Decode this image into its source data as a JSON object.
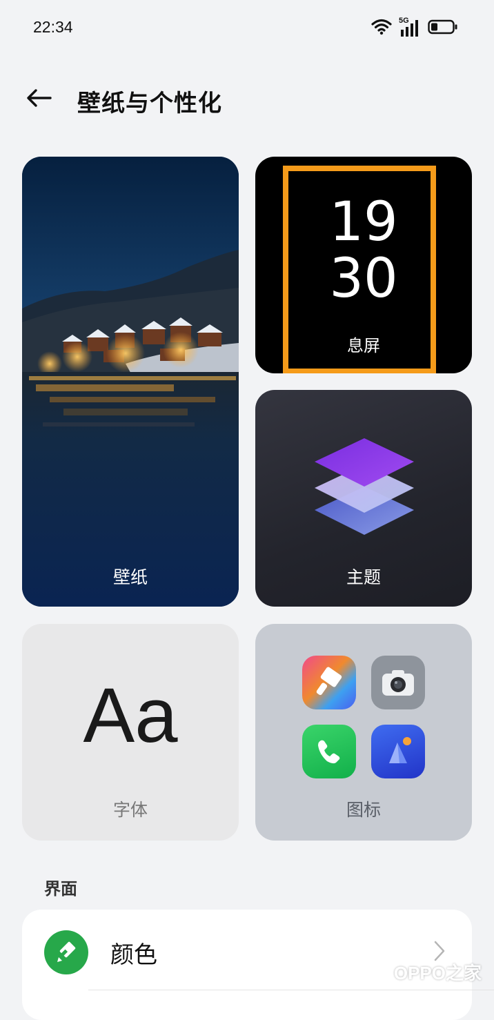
{
  "status_bar": {
    "time": "22:34",
    "network": "5G",
    "icons": [
      "wifi-icon",
      "signal-icon",
      "battery-icon"
    ]
  },
  "header": {
    "back_icon": "back-arrow-icon",
    "title": "壁纸与个性化"
  },
  "cards": {
    "wallpaper": {
      "label": "壁纸"
    },
    "aod": {
      "label": "息屏",
      "hour": "19",
      "minute": "30"
    },
    "theme": {
      "label": "主题"
    },
    "font": {
      "label": "字体",
      "sample": "Aa"
    },
    "icons": {
      "label": "图标",
      "apps": [
        "theme-store-icon",
        "camera-icon",
        "phone-icon",
        "gallery-icon"
      ]
    }
  },
  "section": {
    "title": "界面",
    "items": [
      {
        "label": "颜色",
        "icon": "color-palette-icon"
      }
    ]
  },
  "watermark": {
    "text": "OPPO之家"
  },
  "colors": {
    "background": "#f2f3f5",
    "highlight": "#f59b1a",
    "color_item_icon": "#27a84a"
  }
}
